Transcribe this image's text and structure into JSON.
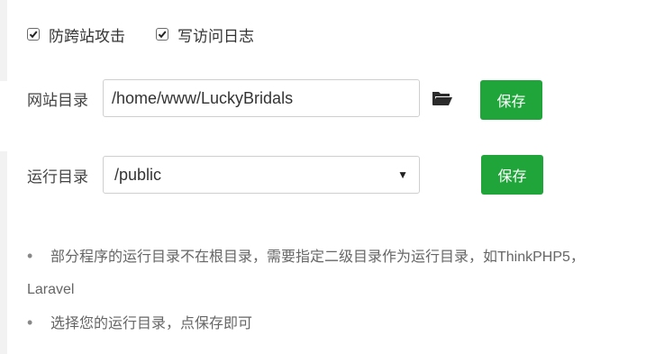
{
  "checkboxes": [
    {
      "label": "防跨站攻击",
      "checked": true
    },
    {
      "label": "写访问日志",
      "checked": true
    }
  ],
  "site_dir": {
    "label": "网站目录",
    "value": "/home/www/LuckyBridals",
    "save_label": "保存",
    "folder_icon": "folder-open-icon"
  },
  "run_dir": {
    "label": "运行目录",
    "selected": "/public",
    "save_label": "保存"
  },
  "tips": [
    {
      "text": "部分程序的运行目录不在根目录，需要指定二级目录作为运行目录，如ThinkPHP5，",
      "continuation": "Laravel"
    },
    {
      "text": "选择您的运行目录，点保存即可"
    }
  ],
  "colors": {
    "accent": "#20a53a",
    "text": "#333333",
    "tip_text": "#666666",
    "input_border": "#cfcfcf"
  }
}
